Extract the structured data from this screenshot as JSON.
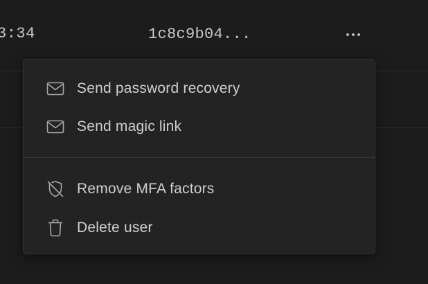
{
  "row": {
    "time_fragment": "3:34",
    "user_id": "1c8c9b04..."
  },
  "menu": {
    "items": [
      {
        "label": "Send password recovery",
        "icon": "mail-icon"
      },
      {
        "label": "Send magic link",
        "icon": "mail-icon"
      },
      {
        "label": "Remove MFA factors",
        "icon": "shield-off-icon"
      },
      {
        "label": "Delete user",
        "icon": "trash-icon"
      }
    ]
  },
  "colors": {
    "background": "#1c1c1c",
    "menu_background": "#232323",
    "text": "#cfcfcf",
    "icon": "#a8a8a8"
  }
}
